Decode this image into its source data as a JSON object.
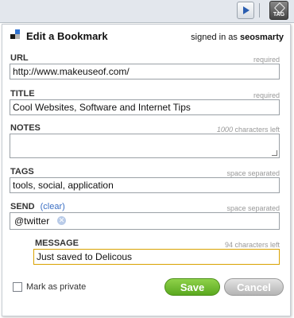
{
  "toolbar": {
    "tag_icon_text": "TAG"
  },
  "header": {
    "title": "Edit a Bookmark",
    "signed_prefix": "signed in as",
    "username": "seosmarty"
  },
  "url": {
    "label": "URL",
    "hint": "required",
    "value": "http://www.makeuseof.com/"
  },
  "title_field": {
    "label": "TITLE",
    "hint": "required",
    "value": "Cool Websites, Software and Internet Tips"
  },
  "notes": {
    "label": "NOTES",
    "hint_count": "1000",
    "hint_suffix": "characters left",
    "value": ""
  },
  "tags": {
    "label": "TAGS",
    "hint": "space separated",
    "value": "tools, social, application"
  },
  "send": {
    "label": "SEND",
    "clear_label": "(clear)",
    "hint": "space separated",
    "recipient": "@twitter"
  },
  "message": {
    "label": "MESSAGE",
    "hint": "94 characters left",
    "value": "Just saved to Delicous"
  },
  "private": {
    "label": "Mark as private",
    "checked": false
  },
  "buttons": {
    "save": "Save",
    "cancel": "Cancel"
  }
}
